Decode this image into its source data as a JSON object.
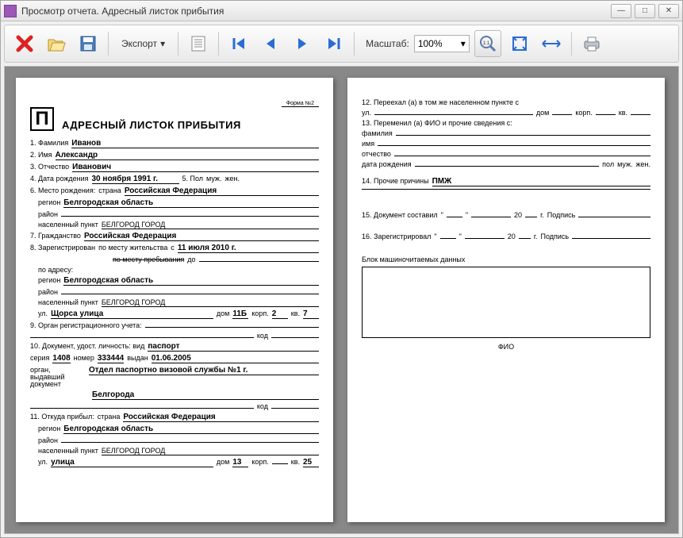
{
  "window": {
    "title": "Просмотр отчета. Адресный листок прибытия"
  },
  "toolbar": {
    "export": "Экспорт",
    "zoom_label": "Масштаб:",
    "zoom_value": "100%"
  },
  "form": {
    "form_no": "Форма №2",
    "p": "П",
    "title": "АДРЕСНЫЙ ЛИСТОК ПРИБЫТИЯ",
    "f1_lbl": "1. Фамилия",
    "f1": "Иванов",
    "f2_lbl": "2. Имя",
    "f2": "Александр",
    "f3_lbl": "3. Отчество",
    "f3": "Иванович",
    "f4_lbl": "4. Дата рождения",
    "f4": "30 ноября 1991 г.",
    "f5_lbl": "5. Пол",
    "f5a": "муж.",
    "f5b": "жен.",
    "f6_lbl": "6. Место рождения:",
    "country_lbl": "страна",
    "country": "Российская Федерация",
    "region_lbl": "регион",
    "region": "Белгородская область",
    "district_lbl": "район",
    "locality_lbl": "населенный пункт",
    "locality": "БЕЛГОРОД ГОРОД",
    "f7_lbl": "7. Гражданство",
    "f7": "Российская Федерация",
    "f8_lbl": "8. Зарегистрирован",
    "residence_lbl": "по месту жительства",
    "residence_c": "с",
    "residence_date": "11 июля 2010 г.",
    "stay_lbl": "по месту пребывания",
    "stay_to": "до",
    "address_lbl": "по адресу:",
    "street_lbl": "ул.",
    "street": "Щорса улица",
    "house_lbl": "дом",
    "house": "11Б",
    "korp_lbl": "корп.",
    "korp": "2",
    "kv_lbl": "кв.",
    "kv": "7",
    "f9_lbl": "9. Орган регистрационного учета:",
    "code_lbl": "код",
    "f10_lbl": "10. Документ, удост. личность: вид",
    "doc_type": "паспорт",
    "series_lbl": "серия",
    "series": "1408",
    "num_lbl": "номер",
    "num": "333444",
    "issued_lbl": "выдан",
    "issued": "01.06.2005",
    "issuer_lbl": "орган, выдавший документ",
    "issuer1": "Отдел паспортно визовой службы №1 г.",
    "issuer2": "Белгорода",
    "f11_lbl": "11. Откуда прибыл:",
    "street2": "улица",
    "house2": "13",
    "kv2": "25",
    "f12_lbl": "12. Переехал (а) в том же населенном пункте с",
    "f13_lbl": "13. Переменил (а) ФИО и прочие сведения с:",
    "fam_lbl": "фамилия",
    "name_lbl": "имя",
    "otc_lbl": "отчество",
    "dob_lbl": "дата рождения",
    "sex_lbl": "пол",
    "f14_lbl": "14. Прочие причины",
    "f14": "ПМЖ",
    "f15_lbl": "15. Документ составил",
    "f16_lbl": "16. Зарегистрировал",
    "year_lbl": "20",
    "year_g": "г.",
    "sign_lbl": "Подпись",
    "block_lbl": "Блок машиночитаемых данных",
    "fio_lbl": "ФИО"
  }
}
